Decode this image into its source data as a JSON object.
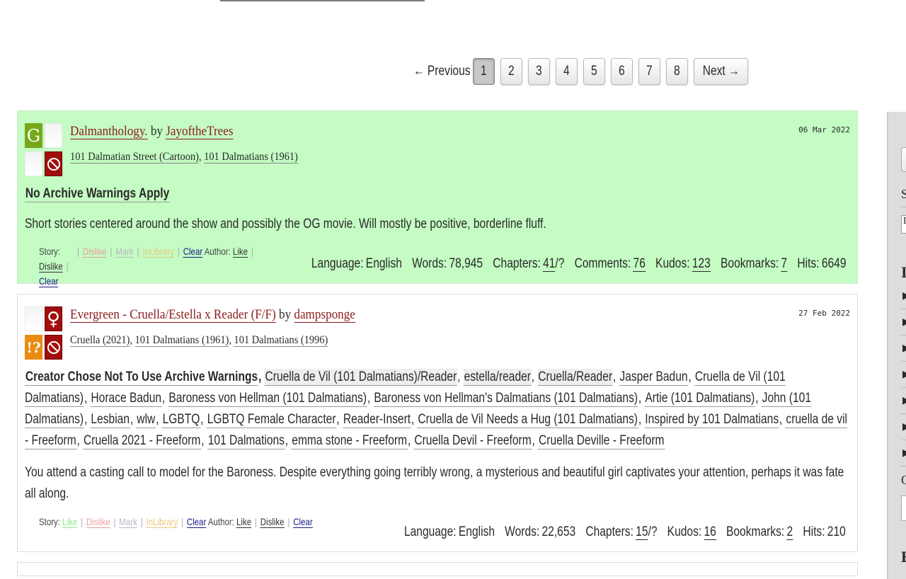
{
  "pagination": {
    "previous": "← Previous",
    "next": "Next →",
    "pages": [
      "1",
      "2",
      "3",
      "4",
      "5",
      "6",
      "7",
      "8"
    ],
    "current": "1"
  },
  "works": [
    {
      "title": "Dalmanthology.",
      "by": "by",
      "author": "JayoftheTrees",
      "date": "06 Mar 2022",
      "fandoms": [
        "101 Dalmatian Street (Cartoon)",
        "101 Dalmatians (1961)"
      ],
      "icons": {
        "rating": "G",
        "rating_name": "rating-general-icon",
        "category": "blank",
        "warning": "blank",
        "complete": "no-incomplete-icon"
      },
      "warnings": [
        "No Archive Warnings Apply"
      ],
      "relationships": [],
      "freeforms": [],
      "summary": "Short stories centered around the show and possibly the OG movie. Will mostly be positive, borderline fluff.",
      "kudo_links": {
        "story_label": "Story:",
        "like": "",
        "dislike": "Dislike",
        "mark": "Mark",
        "inlibrary": "InLibrary",
        "clear": "Clear",
        "author_label": "Author:",
        "author_like": "Like",
        "author_dislike": "Dislike",
        "author_clear": "Clear"
      },
      "stats": {
        "language_label": "Language:",
        "language": "English",
        "words_label": "Words:",
        "words": "78,945",
        "chapters_label": "Chapters:",
        "chapters_done": "41",
        "chapters_total": "/?",
        "comments_label": "Comments:",
        "comments": "76",
        "kudos_label": "Kudos:",
        "kudos": "123",
        "bookmarks_label": "Bookmarks:",
        "bookmarks": "7",
        "hits_label": "Hits:",
        "hits": "6649"
      },
      "highlight_color": "#c4fcc4"
    },
    {
      "title": "Evergreen - Cruella/Estella x Reader (F/F)",
      "by": "by",
      "author": "dampsponge",
      "date": "27 Feb 2022",
      "fandoms": [
        "Cruella (2021)",
        "101 Dalmatians (1961)",
        "101 Dalmatians (1996)"
      ],
      "icons": {
        "rating": "",
        "category": "♀",
        "warning": "!?",
        "complete": "no-incomplete-icon"
      },
      "warnings": [
        "Creator Chose Not To Use Archive Warnings"
      ],
      "relationships": [
        "Cruella de Vil (101 Dalmatians)/Reader",
        "estella/reader",
        "Cruella/Reader"
      ],
      "freeforms": [
        "Jasper Badun",
        "Cruella de Vil (101 Dalmatians)",
        "Horace Badun",
        "Baroness von Hellman (101 Dalmatians)",
        "Baroness von Hellman's Dalmatians (101 Dalmatians)",
        "Artie (101 Dalmatians)",
        "John (101 Dalmatians)",
        "Lesbian",
        "wlw",
        "LGBTQ",
        "LGBTQ Female Character",
        "Reader-Insert",
        "Cruella de Vil Needs a Hug (101 Dalmatians)",
        "Inspired by 101 Dalmatians",
        "cruella de vil - Freeform",
        "Cruella 2021 - Freeform",
        "101 Dalmations",
        "emma stone - Freeform",
        "Cruella Devil - Freeform",
        "Cruella Deville - Freeform"
      ],
      "summary": "You attend a casting call to model for the Baroness. Despite everything going terribly wrong, a mysterious and beautiful girl captivates your attention, perhaps it was fate all along.",
      "kudo_links": {
        "story_label": "Story:",
        "like": "Like",
        "dislike": "Dislike",
        "mark": "Mark",
        "inlibrary": "InLibrary",
        "clear": "Clear",
        "author_label": "Author:",
        "author_like": "Like",
        "author_dislike": "Dislike",
        "author_clear": "Clear"
      },
      "stats": {
        "language_label": "Language:",
        "language": "English",
        "words_label": "Words:",
        "words": "22,653",
        "chapters_label": "Chapters:",
        "chapters_done": "15",
        "chapters_total": "/?",
        "kudos_label": "Kudos:",
        "kudos": "16",
        "bookmarks_label": "Bookmarks:",
        "bookmarks": "2",
        "hits_label": "Hits:",
        "hits": "210"
      }
    }
  ],
  "sidebar": {
    "label_s": "S",
    "select_value": "D",
    "heading_i": "I",
    "label_o": "O",
    "heading_e": "E"
  }
}
